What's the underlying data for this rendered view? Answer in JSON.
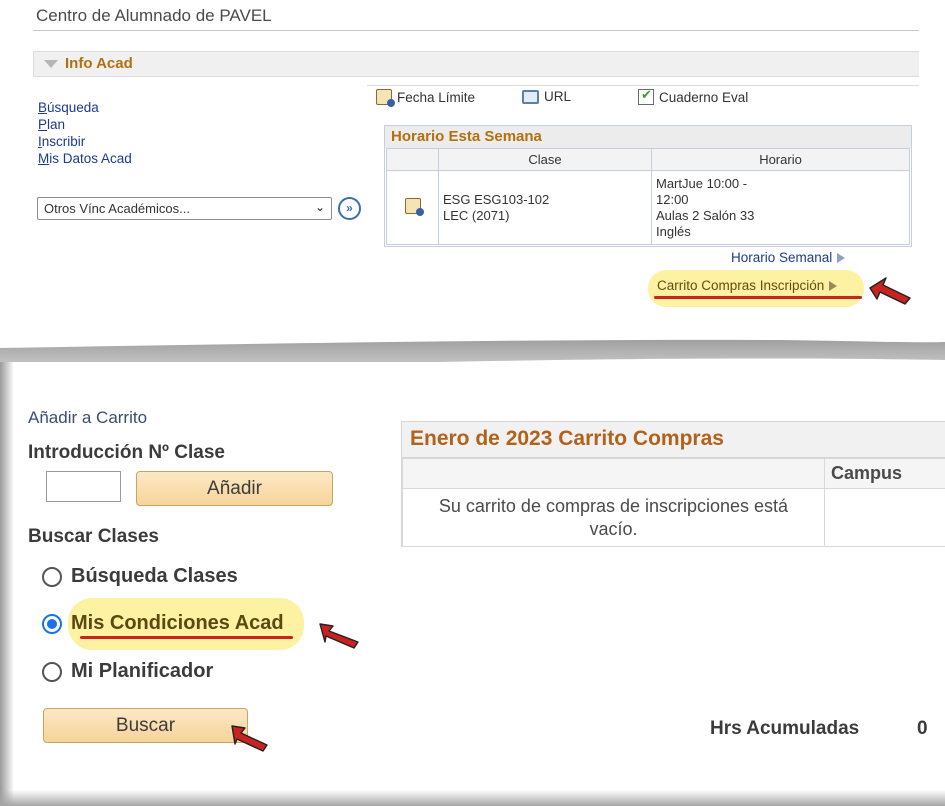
{
  "top": {
    "page_title": "Centro de Alumnado de PAVEL",
    "section_title": "Info Acad",
    "nav_links": [
      "Búsqueda",
      "Plan",
      "Inscribir",
      "Mis Datos Acad"
    ],
    "other_links_select": "Otros Vínc Académicos...",
    "tools": {
      "deadline": "Fecha Límite",
      "url": "URL",
      "gradebook": "Cuaderno Eval"
    },
    "schedule": {
      "title": "Horario Esta Semana",
      "columns": [
        "Clase",
        "Horario"
      ],
      "row": {
        "class_line1": "ESG ESG103-102",
        "class_line2": "LEC (2071)",
        "time_line1": "MartJue 10:00 -",
        "time_line2": "12:00",
        "room": "Aulas 2 Salón  33",
        "language": "Inglés"
      }
    },
    "weekly_schedule_link": "Horario Semanal",
    "enrollment_cart_link": "Carrito Compras Inscripción"
  },
  "bottom": {
    "add_to_cart_title": "Añadir a Carrito",
    "class_number_label": "Introducción Nº Clase",
    "class_number_value": "",
    "add_button": "Añadir",
    "search_classes_label": "Buscar Clases",
    "search_options": [
      {
        "label": "Búsqueda Clases",
        "selected": false
      },
      {
        "label": "Mis Condiciones Acad",
        "selected": true
      },
      {
        "label": "Mi Planificador",
        "selected": false
      }
    ],
    "search_button": "Buscar",
    "cart": {
      "title": "Enero de 2023 Carrito Compras",
      "column_campus": "Campus",
      "empty_message": "Su carrito de compras de inscripciones está vacío."
    },
    "accumulated_hours_label": "Hrs Acumuladas",
    "accumulated_hours_value": "0"
  },
  "colors": {
    "accent_orange": "#b3700f",
    "link_blue": "#1c3b8c",
    "highlight_yellow": "#fdf1a2",
    "annotation_red": "#c8231f"
  }
}
